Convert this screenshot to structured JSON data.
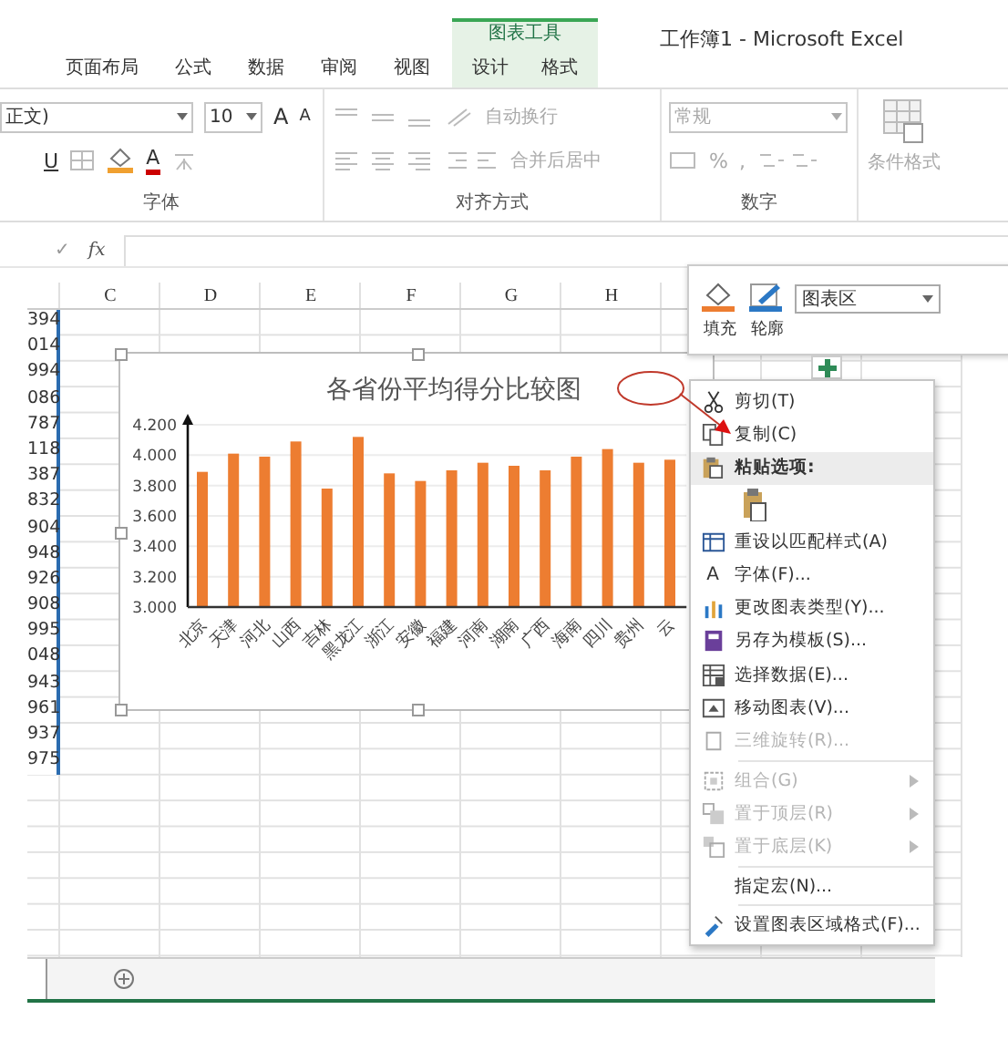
{
  "window": {
    "title": "工作簿1 - Microsoft Excel"
  },
  "ribbon_tabs": [
    {
      "label": "页面布局",
      "selected": false
    },
    {
      "label": "公式",
      "selected": false
    },
    {
      "label": "数据",
      "selected": false
    },
    {
      "label": "审阅",
      "selected": false
    },
    {
      "label": "视图",
      "selected": false
    }
  ],
  "chart_tools": {
    "title": "图表工具",
    "tabs": [
      {
        "label": "设计",
        "selected": false
      },
      {
        "label": "格式",
        "selected": false
      }
    ]
  },
  "ribbon": {
    "font": {
      "name": "正文)",
      "size": "10",
      "grow": "A",
      "shrink": "A",
      "underline": "U",
      "font_color": "A",
      "label": "字体"
    },
    "alignment": {
      "wrap": "自动换行",
      "merge": "合并后居中",
      "label": "对齐方式"
    },
    "number": {
      "format": "常规",
      "percent": "%",
      "comma": ",",
      "label": "数字"
    },
    "styles": {
      "conditional": "条件格式"
    }
  },
  "formula_bar": {
    "enter": "✓",
    "function": "fx"
  },
  "sheet": {
    "columns": [
      "C",
      "D",
      "E",
      "F",
      "G",
      "H"
    ],
    "column_b": [
      "394",
      "014",
      "994",
      "086",
      "787",
      "118",
      "387",
      "832",
      "904",
      "948",
      "926",
      "908",
      "995",
      "048",
      "943",
      "961",
      "937",
      "975"
    ]
  },
  "chart": {
    "chart_data": {
      "type": "bar",
      "title": "各省份平均得分比较图",
      "categories": [
        "北京",
        "天津",
        "河北",
        "山西",
        "吉林",
        "黑龙江",
        "浙江",
        "安徽",
        "福建",
        "河南",
        "湖南",
        "广西",
        "海南",
        "四川",
        "贵州",
        "云"
      ],
      "values": [
        3.89,
        4.01,
        3.99,
        4.09,
        3.78,
        4.12,
        3.88,
        3.83,
        3.9,
        3.95,
        3.93,
        3.9,
        3.99,
        4.04,
        3.95,
        3.97
      ],
      "ylim": [
        3,
        4.2
      ],
      "grid": true,
      "yticks": [
        {
          "value": 3,
          "label": "3.000"
        },
        {
          "value": 3.2,
          "label": "3.200"
        },
        {
          "value": 3.4,
          "label": "3.400"
        },
        {
          "value": 3.6,
          "label": "3.600"
        },
        {
          "value": 3.8,
          "label": "3.800"
        },
        {
          "value": 4,
          "label": "4.000"
        },
        {
          "value": 4.2,
          "label": "4.200"
        }
      ]
    }
  },
  "format_toolbar": {
    "fill": "填充",
    "outline": "轮廓",
    "element": "图表区"
  },
  "context_menu": {
    "items": [
      {
        "kind": "command",
        "label": "剪切(T)",
        "disabled": false,
        "submenu": false
      },
      {
        "kind": "command",
        "label": "复制(C)",
        "disabled": false,
        "submenu": false
      },
      {
        "kind": "header",
        "label": "粘贴选项:"
      },
      {
        "kind": "paste"
      },
      {
        "kind": "command",
        "label": "重设以匹配样式(A)",
        "disabled": false,
        "submenu": false
      },
      {
        "kind": "command",
        "label": "字体(F)...",
        "glyph": "A",
        "disabled": false,
        "submenu": false
      },
      {
        "kind": "command",
        "label": "更改图表类型(Y)...",
        "disabled": false,
        "submenu": false
      },
      {
        "kind": "command",
        "label": "另存为模板(S)...",
        "disabled": false,
        "submenu": false
      },
      {
        "kind": "command",
        "label": "选择数据(E)...",
        "disabled": false,
        "submenu": false
      },
      {
        "kind": "command",
        "label": "移动图表(V)...",
        "disabled": false,
        "submenu": false
      },
      {
        "kind": "command",
        "label": "三维旋转(R)...",
        "disabled": true,
        "submenu": false
      },
      {
        "kind": "separator"
      },
      {
        "kind": "command",
        "label": "组合(G)",
        "disabled": true,
        "submenu": true
      },
      {
        "kind": "command",
        "label": "置于顶层(R)",
        "disabled": true,
        "submenu": true
      },
      {
        "kind": "command",
        "label": "置于底层(K)",
        "disabled": true,
        "submenu": true
      },
      {
        "kind": "separator"
      },
      {
        "kind": "command",
        "label": "指定宏(N)...",
        "disabled": false,
        "submenu": false
      },
      {
        "kind": "separator"
      },
      {
        "kind": "command",
        "label": "设置图表区域格式(F)...",
        "disabled": false,
        "submenu": false
      }
    ]
  }
}
